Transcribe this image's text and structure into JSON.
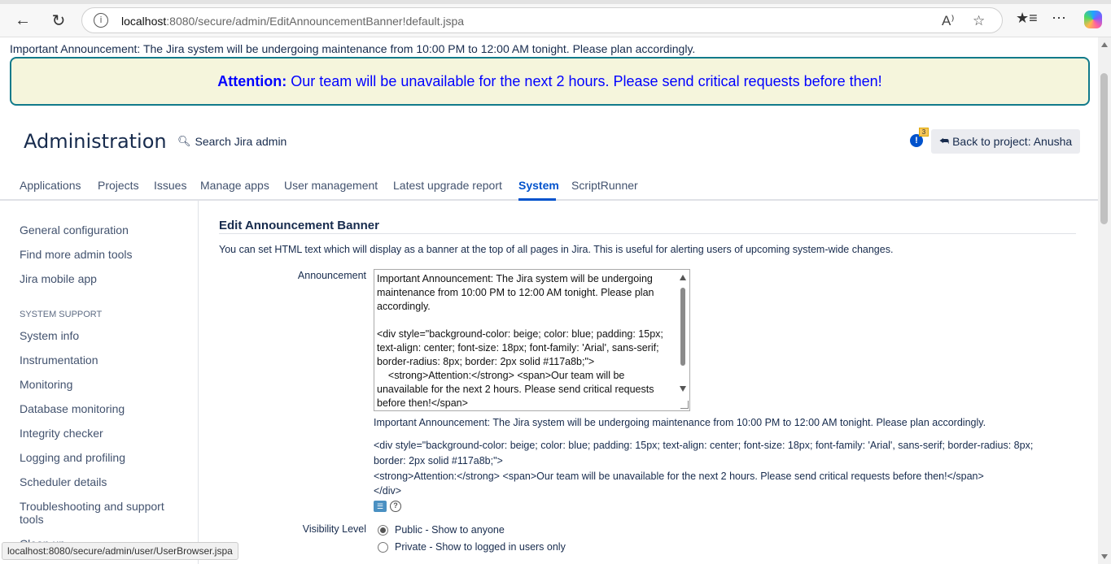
{
  "browser": {
    "url_host": "localhost",
    "url_path": ":8080/secure/admin/EditAnnouncementBanner!default.jspa",
    "status_url": "localhost:8080/secure/admin/user/UserBrowser.jspa"
  },
  "announcement": {
    "text": "Important Announcement: The Jira system will be undergoing maintenance from 10:00 PM to 12:00 AM tonight. Please plan accordingly.",
    "banner_strong": "Attention:",
    "banner_span": "Our team will be unavailable for the next 2 hours. Please send critical requests before then!"
  },
  "header": {
    "title": "Administration",
    "search_label": "Search Jira admin",
    "notification_count": "3",
    "back_button": "Back to project: Anusha"
  },
  "tabs": [
    {
      "label": "Applications"
    },
    {
      "label": "Projects"
    },
    {
      "label": "Issues"
    },
    {
      "label": "Manage apps"
    },
    {
      "label": "User management"
    },
    {
      "label": "Latest upgrade report"
    },
    {
      "label": "System"
    },
    {
      "label": "ScriptRunner"
    }
  ],
  "sidebar": {
    "top_items": [
      "General configuration",
      "Find more admin tools",
      "Jira mobile app"
    ],
    "section_heading": "SYSTEM SUPPORT",
    "section_items": [
      "System info",
      "Instrumentation",
      "Monitoring",
      "Database monitoring",
      "Integrity checker",
      "Logging and profiling",
      "Scheduler details",
      "Troubleshooting and support tools",
      "Clean up"
    ]
  },
  "main": {
    "title": "Edit Announcement Banner",
    "description": "You can set HTML text which will display as a banner at the top of all pages in Jira. This is useful for alerting users of upcoming system-wide changes.",
    "announcement_label": "Announcement",
    "textarea_value": "Important Announcement: The Jira system will be undergoing maintenance from 10:00 PM to 12:00 AM tonight. Please plan accordingly.\n\n<div style=\"background-color: beige; color: blue; padding: 15px; text-align: center; font-size: 18px; font-family: 'Arial', sans-serif; border-radius: 8px; border: 2px solid #117a8b;\">\n    <strong>Attention:</strong> <span>Our team will be unavailable for the next 2 hours. Please send critical requests before then!</span>",
    "preview_line1": "Important Announcement: The Jira system will be undergoing maintenance from 10:00 PM to 12:00 AM tonight. Please plan accordingly.",
    "preview_line2": "<div style=\"background-color: beige; color: blue; padding: 15px; text-align: center; font-size: 18px; font-family: 'Arial', sans-serif; border-radius: 8px;",
    "preview_line3": "border: 2px solid #117a8b;\">",
    "preview_line4": "<strong>Attention:</strong> <span>Our team will be unavailable for the next 2 hours. Please send critical requests before then!</span>",
    "preview_line5": "</div>",
    "visibility_label": "Visibility Level",
    "visibility_options": [
      {
        "label": "Public - Show to anyone",
        "selected": true
      },
      {
        "label": "Private - Show to logged in users only",
        "selected": false
      }
    ]
  },
  "colors": {
    "banner_bg": "#f5f5dc",
    "banner_text": "#0000ff",
    "banner_border": "#117a8b",
    "accent": "#0052cc"
  }
}
